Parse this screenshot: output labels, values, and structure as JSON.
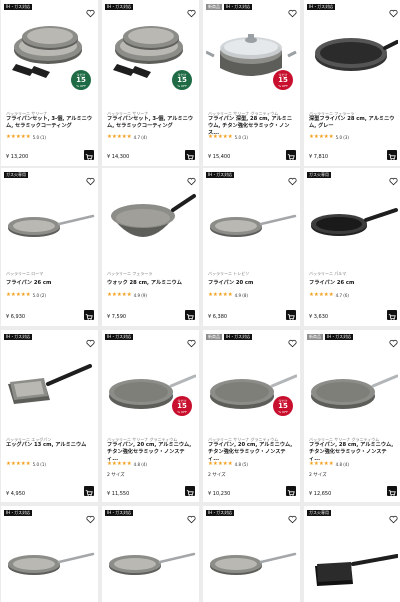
{
  "colors": {
    "star": "#f3a01e",
    "promo_green": "#1f6b45",
    "promo_red": "#c8102e",
    "badge_dark": "#111111",
    "badge_grey": "#8e8e8e"
  },
  "products": [
    {
      "badges": [
        "IH・ガス対応"
      ],
      "image": "pan-set-with-handles-icon",
      "promo": {
        "text_top": "今だけ",
        "value": "15",
        "text_bottom": "% OFF",
        "color": "green"
      },
      "brand": "バッラリーニ サリーナ",
      "title": "フライパンセット, 3-個, アルミニウム, セラミックコーティング",
      "stars": "★★★★★",
      "count": "5.0 (1)",
      "sizes": "",
      "price": "¥ 13,200"
    },
    {
      "badges": [
        "IH・ガス対応"
      ],
      "image": "pan-set-with-handles-icon",
      "promo": {
        "text_top": "今だけ",
        "value": "15",
        "text_bottom": "% OFF",
        "color": "green"
      },
      "brand": "バッラリーニ サリーナ",
      "title": "フライパンセット, 3-個, アルミニウム, セラミックコーティング",
      "stars": "★★★★★",
      "count": "4.7 (4)",
      "sizes": "",
      "price": "¥ 14,300"
    },
    {
      "badges": [
        "新商品",
        "IH・ガス対応"
      ],
      "image": "deep-pan-with-lid-icon",
      "promo": {
        "text_top": "今だけ",
        "value": "15",
        "text_bottom": "% OFF",
        "color": "red"
      },
      "brand": "バッラリーニ サリーナ グラニティウム",
      "title": "フライパン 深型, 28 cm, アルミニウム, チタン強化セラミック・ノンス...",
      "stars": "★★★★★",
      "count": "5.0 (1)",
      "sizes": "",
      "price": "¥ 15,400"
    },
    {
      "badges": [
        "IH・ガス対応"
      ],
      "image": "dark-deep-pan-icon",
      "promo": null,
      "brand": "バッラリーニ フェラーラ",
      "title": "深型フライパン 28 cm, アルミニウム, グレー",
      "stars": "★★★★★",
      "count": "5.0 (3)",
      "sizes": "",
      "price": "¥ 7,810"
    },
    {
      "badges": [
        "ガス火専用"
      ],
      "image": "grey-frypan-icon",
      "promo": null,
      "brand": "バッラリーニ ローマ",
      "title": "フライパン 26 cm",
      "stars": "★★★★★",
      "count": "5.0 (2)",
      "sizes": "",
      "price": "¥ 6,930"
    },
    {
      "badges": [],
      "image": "grey-wok-icon",
      "promo": null,
      "brand": "バッラリーニ フェラーラ",
      "title": "ウォック 28 cm, アルミニウム",
      "stars": "★★★★★",
      "count": "4.9 (9)",
      "sizes": "",
      "price": "¥ 7,590"
    },
    {
      "badges": [
        "IH・ガス対応"
      ],
      "image": "grey-frypan-icon",
      "promo": null,
      "brand": "バッラリーニ トレビソ",
      "title": "フライパン 20 cm",
      "stars": "★★★★★",
      "count": "4.9 (8)",
      "sizes": "",
      "price": "¥ 6,380"
    },
    {
      "badges": [
        "ガス火専用"
      ],
      "image": "black-frypan-icon",
      "promo": null,
      "brand": "バッラリーニ パルマ",
      "title": "フライパン 26 cm",
      "stars": "★★★★★",
      "count": "4.7 (6)",
      "sizes": "",
      "price": "¥ 3,630"
    },
    {
      "badges": [
        "IH・ガス対応"
      ],
      "image": "egg-pan-icon",
      "promo": null,
      "brand": "バッラリーニ エッグパン",
      "title": "エッグパン 13 cm, アルミニウム",
      "stars": "★★★★★",
      "count": "5.0 (1)",
      "sizes": "",
      "price": "¥ 4,950"
    },
    {
      "badges": [
        "IH・ガス対応"
      ],
      "image": "granitium-frypan-icon",
      "promo": {
        "text_top": "今だけ",
        "value": "15",
        "text_bottom": "% OFF",
        "color": "red"
      },
      "brand": "バッラリーニ サリーナ グラニティウム",
      "title": "フライパン, 20 cm, アルミニウム, チタン強化セラミック・ノンスティ...",
      "stars": "★★★★★",
      "count": "4.8 (4)",
      "sizes": "2 サイズ",
      "price": "¥ 11,550"
    },
    {
      "badges": [
        "新商品",
        "IH・ガス対応"
      ],
      "image": "granitium-frypan-icon",
      "promo": {
        "text_top": "今だけ",
        "value": "15",
        "text_bottom": "% OFF",
        "color": "red"
      },
      "brand": "バッラリーニ サリーナ グラニティウム",
      "title": "フライパン, 20 cm, アルミニウム, チタン強化セラミック・ノンスティ...",
      "stars": "★★★★★",
      "count": "4.8 (5)",
      "sizes": "2 サイズ",
      "price": "¥ 10,230"
    },
    {
      "badges": [
        "新商品",
        "IH・ガス対応"
      ],
      "image": "granitium-frypan-icon",
      "promo": null,
      "brand": "バッラリーニ サリーナ グラニティウム",
      "title": "フライパン, 28 cm, アルミニウム, チタン強化セラミック・ノンスティ...",
      "stars": "★★★★★",
      "count": "4.8 (4)",
      "sizes": "2 サイズ",
      "price": "¥ 12,650"
    },
    {
      "badges": [
        "IH・ガス対応"
      ],
      "image": "grey-frypan-icon",
      "promo": null,
      "brand": "",
      "title": "",
      "stars": "",
      "count": "",
      "sizes": "",
      "price": ""
    },
    {
      "badges": [
        "IH・ガス対応"
      ],
      "image": "grey-frypan-icon",
      "promo": null,
      "brand": "",
      "title": "",
      "stars": "",
      "count": "",
      "sizes": "",
      "price": ""
    },
    {
      "badges": [
        "IH・ガス対応"
      ],
      "image": "grey-frypan-icon",
      "promo": null,
      "brand": "",
      "title": "",
      "stars": "",
      "count": "",
      "sizes": "",
      "price": ""
    },
    {
      "badges": [
        "ガス火専用"
      ],
      "image": "square-egg-pan-icon",
      "promo": null,
      "brand": "",
      "title": "",
      "stars": "",
      "count": "",
      "sizes": "",
      "price": ""
    }
  ]
}
